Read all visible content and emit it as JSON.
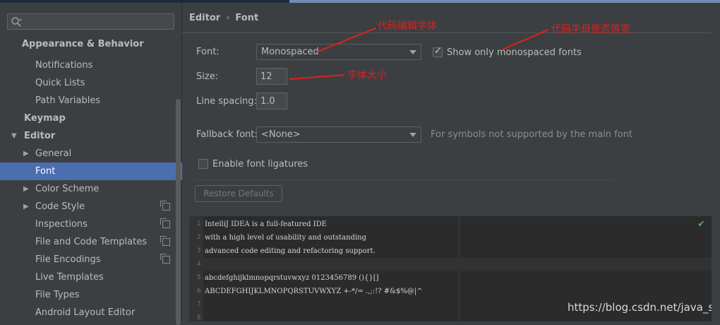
{
  "colors": {
    "selection": "#4b6eaf",
    "annotation": "#e02020",
    "background": "#3c3f41",
    "editor_bg": "#2b2b2b"
  },
  "sidebar": {
    "search": {
      "placeholder": "",
      "icon": "search-icon"
    },
    "items": [
      {
        "label": "Appearance & Behavior",
        "bold": true
      },
      {
        "label": "Notifications"
      },
      {
        "label": "Quick Lists"
      },
      {
        "label": "Path Variables"
      },
      {
        "label": "Keymap",
        "bold": true
      },
      {
        "label": "Editor",
        "bold": true,
        "expanded": true
      },
      {
        "label": "General",
        "collapsed": true
      },
      {
        "label": "Font",
        "selected": true
      },
      {
        "label": "Color Scheme",
        "collapsed": true
      },
      {
        "label": "Code Style",
        "collapsed": true,
        "copy_icon": true
      },
      {
        "label": "Inspections",
        "copy_icon": true
      },
      {
        "label": "File and Code Templates",
        "copy_icon": true
      },
      {
        "label": "File Encodings",
        "copy_icon": true
      },
      {
        "label": "Live Templates"
      },
      {
        "label": "File Types"
      },
      {
        "label": "Android Layout Editor"
      }
    ]
  },
  "breadcrumb": {
    "section": "Editor",
    "separator": "›",
    "page": "Font"
  },
  "form": {
    "font_label": "Font:",
    "font_value": "Monospaced",
    "monospaced_only_label": "Show only monospaced fonts",
    "monospaced_only_checked": true,
    "size_label": "Size:",
    "size_value": "12",
    "line_spacing_label": "Line spacing:",
    "line_spacing_value": "1.0",
    "fallback_label": "Fallback font:",
    "fallback_value": "<None>",
    "fallback_hint": "For symbols not supported by the main font",
    "ligatures_label": "Enable font ligatures",
    "ligatures_checked": false,
    "restore_label": "Restore Defaults"
  },
  "preview": {
    "lines": [
      {
        "num": "1",
        "text": "IntelliJ IDEA is a full-featured IDE"
      },
      {
        "num": "2",
        "text": "with a high level of usability and outstanding"
      },
      {
        "num": "3",
        "text": "advanced code editing and refactoring support."
      },
      {
        "num": "4",
        "text": ""
      },
      {
        "num": "5",
        "text": "abcdefghijklmnopqrstuvwxyz 0123456789 (){}[]"
      },
      {
        "num": "6",
        "text": "ABCDEFGHIJKLMNOPQRSTUVWXYZ +-*/= .,;:!? #&$%@|^"
      },
      {
        "num": "7",
        "text": ""
      },
      {
        "num": "8",
        "text": ""
      }
    ],
    "check_icon": "checkmark-icon"
  },
  "annotations": {
    "code_font": "代码编辑字体",
    "monospaced": "代码字母是否等宽",
    "font_size": "字体大小"
  },
  "watermark": "https://blog.csdn.net/java_shm"
}
